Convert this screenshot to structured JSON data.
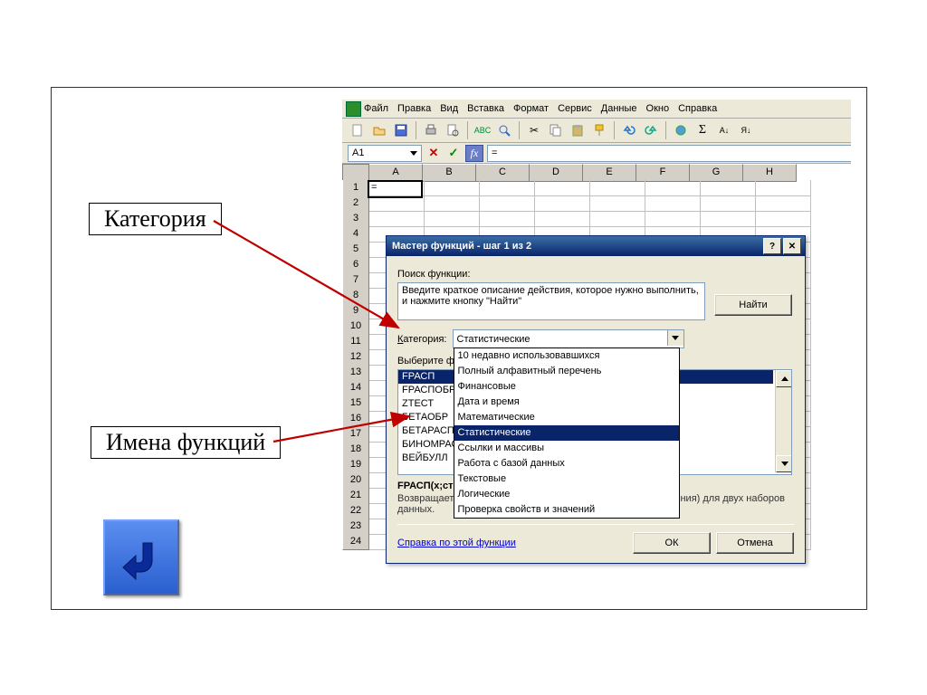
{
  "menu": {
    "items": [
      "Файл",
      "Правка",
      "Вид",
      "Вставка",
      "Формат",
      "Сервис",
      "Данные",
      "Окно",
      "Справка"
    ]
  },
  "namebox": "A1",
  "formula": "=",
  "columns": [
    "A",
    "B",
    "C",
    "D",
    "E",
    "F",
    "G",
    "H"
  ],
  "row_count": 24,
  "active_cell_value": "=",
  "dialog": {
    "title": "Мастер функций - шаг 1 из 2",
    "search_label": "Поиск функции:",
    "search_text": "Введите краткое описание действия, которое нужно выполнить, и нажмите кнопку \"Найти\"",
    "find": "Найти",
    "category_label": "Категория:",
    "category_value": "Статистические",
    "category_options": [
      "10 недавно использовавшихся",
      "Полный алфавитный перечень",
      "Финансовые",
      "Дата и время",
      "Математические",
      "Статистические",
      "Ссылки и массивы",
      "Работа с базой данных",
      "Текстовые",
      "Логические",
      "Проверка свойств и значений"
    ],
    "select_func_label": "Выберите функцию:",
    "functions": [
      "FРАСП",
      "FРАСПОБР",
      "ZТЕСТ",
      "БЕТАОБР",
      "БЕТАРАСП",
      "БИНОМРАСП",
      "ВЕЙБУЛЛ"
    ],
    "selected_function_index": 0,
    "signature": "FРАСП(x;степени_свободы1;степени_свободы2)",
    "description": "Возвращает F-распределение вероятности (степень отклонения) для двух наборов данных.",
    "help_link": "Справка по этой функции",
    "ok": "ОК",
    "cancel": "Отмена"
  },
  "annotations": {
    "category": "Категория",
    "func_names": "Имена функций"
  },
  "icons": {
    "sigma": "Σ",
    "sort_az": "A↓",
    "sort_za": "Я↓"
  }
}
